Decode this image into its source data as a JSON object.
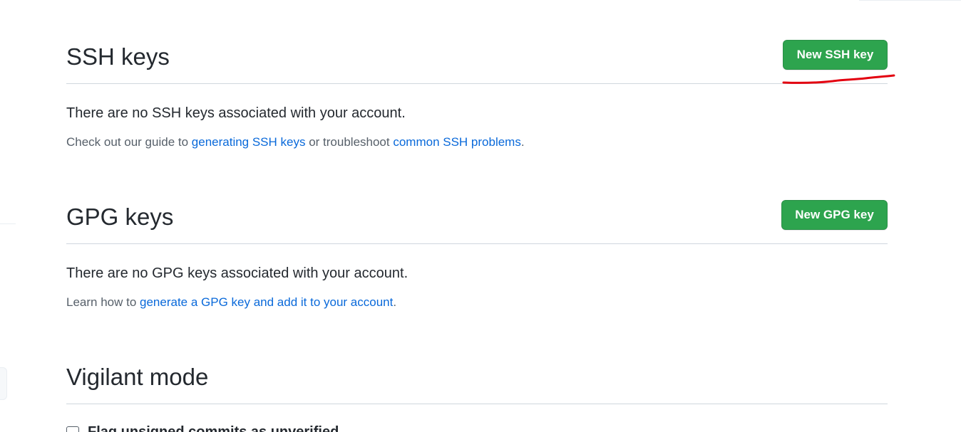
{
  "ssh": {
    "title": "SSH keys",
    "button_label": "New SSH key",
    "empty_message": "There are no SSH keys associated with your account.",
    "help_prefix": "Check out our guide to ",
    "help_link1": "generating SSH keys",
    "help_middle": " or troubleshoot ",
    "help_link2": "common SSH problems",
    "help_suffix": "."
  },
  "gpg": {
    "title": "GPG keys",
    "button_label": "New GPG key",
    "empty_message": "There are no GPG keys associated with your account.",
    "help_prefix": "Learn how to ",
    "help_link": "generate a GPG key and add it to your account",
    "help_suffix": "."
  },
  "vigilant": {
    "title": "Vigilant mode",
    "checkbox_label": "Flag unsigned commits as unverified"
  },
  "colors": {
    "button_green": "#2da44e",
    "link_blue": "#0969da",
    "annotation_red": "#e3000f"
  }
}
